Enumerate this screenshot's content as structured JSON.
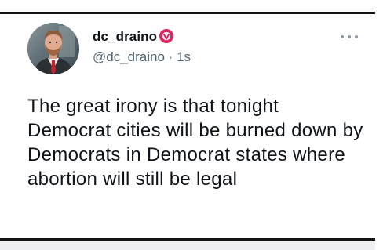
{
  "tweet": {
    "display_name": "dc_draino",
    "handle": "@dc_draino",
    "separator": "·",
    "time": "1s",
    "text": "The great irony is that tonight Democrat cities will be burned down by Democrats in Democrat states where abortion will still be legal"
  },
  "icons": {
    "verified": "verified-badge-icon",
    "more": "more-options-icon"
  },
  "colors": {
    "verified_badge": "#e0245e",
    "name": "#0f1419",
    "secondary": "#536471",
    "rule": "#141414"
  }
}
